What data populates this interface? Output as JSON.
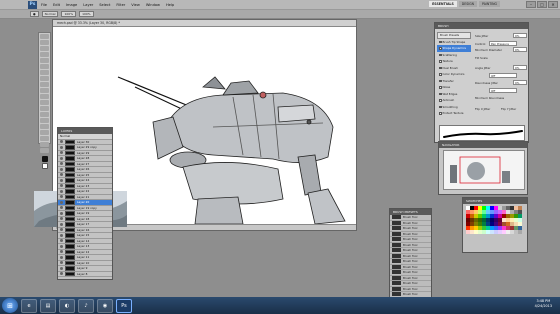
{
  "menubar": {
    "logo": "Ps",
    "items": [
      "File",
      "Edit",
      "Image",
      "Layer",
      "Select",
      "Filter",
      "View",
      "Window",
      "Help"
    ],
    "workspaces": [
      "ESSENTIALS",
      "DESIGN",
      "PAINTING"
    ],
    "window_buttons": [
      "–",
      "□",
      "✕"
    ]
  },
  "options": {
    "mode": "Normal",
    "opacity": "100%",
    "flow": "100%"
  },
  "document": {
    "tab_title": "mech.psd @ 33.3% (Layer 30, RGB/8) *",
    "status": "33.33%"
  },
  "layers": {
    "title": "LAYERS",
    "blend_mode": "Normal",
    "rows": [
      "Layer 30",
      "Layer 29 copy",
      "Layer 29",
      "Layer 28",
      "Layer 27",
      "Layer 26",
      "Layer 25",
      "Layer 24",
      "Layer 23",
      "Layer 22",
      "Layer 21",
      "Layer 20",
      "Layer 19 copy",
      "Layer 19",
      "Layer 18",
      "Layer 17",
      "Layer 16",
      "Layer 15",
      "Layer 14",
      "Layer 13",
      "Layer 12",
      "Layer 11",
      "Layer 10",
      "Layer 9",
      "Layer 8"
    ],
    "selected_index": 11
  },
  "brush_panel": {
    "title": "BRUSH",
    "presets_btn": "Brush Presets",
    "options": [
      "Brush Tip Shape",
      "Shape Dynamics",
      "Scattering",
      "Texture",
      "Dual Brush",
      "Color Dynamics",
      "Transfer",
      "Noise",
      "Wet Edges",
      "Airbrush",
      "Smoothing",
      "Protect Texture"
    ],
    "active_index": 1,
    "fields": {
      "size_jitter_label": "Size Jitter",
      "size_jitter": "0%",
      "control_label": "Control:",
      "control": "Pen Pressure",
      "min_diameter_label": "Minimum Diameter",
      "min_diameter": "0%",
      "tilt_scale_label": "Tilt Scale",
      "tilt_scale": "",
      "angle_jitter_label": "Angle Jitter",
      "angle_jitter": "0%",
      "angle_control": "Off",
      "roundness_jitter_label": "Roundness Jitter",
      "roundness_jitter": "0%",
      "roundness_control": "Off",
      "min_roundness_label": "Minimum Roundness",
      "min_roundness": "",
      "flip_x": "Flip X Jitter",
      "flip_y": "Flip Y Jitter"
    }
  },
  "navigator": {
    "title": "NAVIGATOR",
    "zoom": "33.33%"
  },
  "swatches": {
    "title": "SWATCHES",
    "colors": [
      "#ffffff",
      "#000000",
      "#ff0000",
      "#ffff00",
      "#00ff00",
      "#00ffff",
      "#0000ff",
      "#ff00ff",
      "#cccccc",
      "#999999",
      "#666666",
      "#333333",
      "#f2c1a0",
      "#c08050",
      "#ff6666",
      "#ff9966",
      "#ffcc66",
      "#ccff66",
      "#66ff99",
      "#66ccff",
      "#6699ff",
      "#9966ff",
      "#cc66ff",
      "#ff66cc",
      "#e0e0e0",
      "#b0b0b0",
      "#808080",
      "#505050",
      "#cc0000",
      "#cc6600",
      "#cccc00",
      "#66cc00",
      "#00cc66",
      "#0099cc",
      "#0033cc",
      "#6600cc",
      "#cc0099",
      "#990000",
      "#996600",
      "#999900",
      "#339900",
      "#009966",
      "#660000",
      "#663300",
      "#666600",
      "#336600",
      "#006633",
      "#003366",
      "#000066",
      "#330066",
      "#660033",
      "#ffe0cc",
      "#ffd699",
      "#fff0b3",
      "#e6ffcc",
      "#ccffe6",
      "#800000",
      "#804000",
      "#808000",
      "#408000",
      "#008040",
      "#004080",
      "#000080",
      "#400080",
      "#800040",
      "#a0522d",
      "#d2691e",
      "#deb887",
      "#f5deb3",
      "#fafad2",
      "#ff3300",
      "#ff9900",
      "#ffcc00",
      "#99cc00",
      "#33cc33",
      "#00cc99",
      "#0099ff",
      "#3366ff",
      "#9933ff",
      "#ff33cc",
      "#cc3366",
      "#993333",
      "#669966",
      "#336699",
      "#ffcccc",
      "#ffe5cc",
      "#ffffcc",
      "#e5ffcc",
      "#ccffcc",
      "#ccffff",
      "#cce5ff",
      "#ccccff",
      "#e5ccff",
      "#ffccff",
      "#f0f0f0",
      "#d8d8d8",
      "#c0c0c0",
      "#a8a8a8"
    ]
  },
  "brush_presets": {
    "title": "BRUSH PRESETS",
    "rows": [
      "Brush Tool",
      "Brush Tool",
      "Brush Tool",
      "Brush Tool",
      "Brush Tool",
      "Brush Tool",
      "Brush Tool",
      "Brush Tool",
      "Brush Tool",
      "Brush Tool",
      "Brush Tool",
      "Brush Tool",
      "Brush Tool",
      "Brush Tool",
      "Brush Tool"
    ]
  },
  "taskbar": {
    "start": "⊞",
    "apps": [
      "e",
      "▤",
      "◐",
      "♪",
      "◉",
      "Ps"
    ],
    "time": "3:48 PM",
    "date": "4/24/2013"
  },
  "colors": {
    "selection": "#3f7fd6",
    "panel": "#c3c3c3",
    "workspace": "#8e8e8e"
  }
}
